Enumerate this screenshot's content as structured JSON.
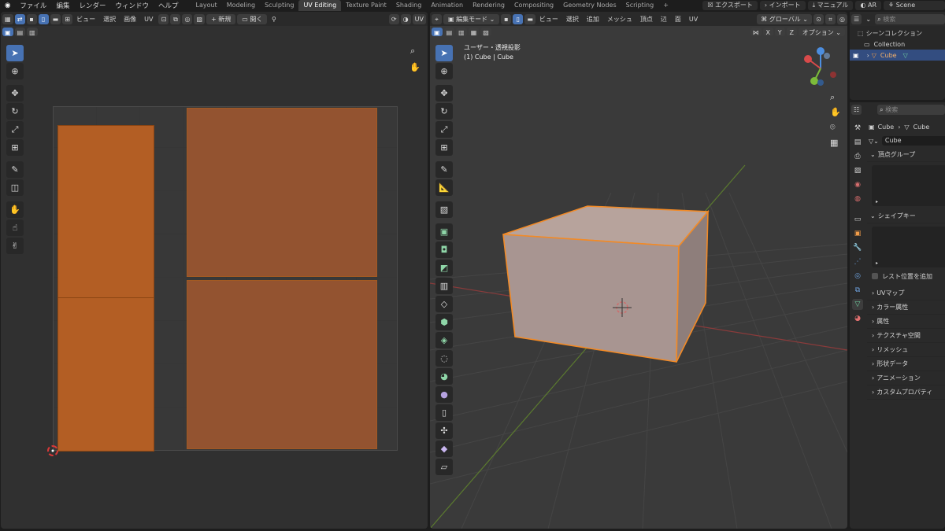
{
  "topbar": {
    "menus": [
      "ファイル",
      "編集",
      "レンダー",
      "ウィンドウ",
      "ヘルプ"
    ],
    "workspaces": [
      "Layout",
      "Modeling",
      "Sculpting",
      "UV Editing",
      "Texture Paint",
      "Shading",
      "Animation",
      "Rendering",
      "Compositing",
      "Geometry Nodes",
      "Scripting"
    ],
    "active_workspace": "UV Editing",
    "add_tab": "+",
    "export": "エクスポート",
    "import": "インポート",
    "manual": "マニュアル",
    "ar": "AR",
    "scene": "Scene"
  },
  "uv_editor": {
    "menus": [
      "ビュー",
      "選択",
      "画像",
      "UV"
    ],
    "new_label": "新規",
    "open_label": "開く",
    "uv_label": "UV"
  },
  "viewport": {
    "mode": "編集モード",
    "menus": [
      "ビュー",
      "選択",
      "追加",
      "メッシュ",
      "頂点",
      "辺",
      "面",
      "UV"
    ],
    "transform": "グローバル",
    "options": "オプション",
    "axes": [
      "X",
      "Y",
      "Z"
    ],
    "overlay_title": "ユーザー・透視投影",
    "overlay_sub": "(1) Cube | Cube"
  },
  "outliner": {
    "search_placeholder": "検索",
    "scene_collection": "シーンコレクション",
    "collection": "Collection",
    "object": "Cube"
  },
  "properties": {
    "search_placeholder": "検索",
    "breadcrumb_object": "Cube",
    "breadcrumb_data": "Cube",
    "mesh_name": "Cube",
    "vertex_groups": "頂点グループ",
    "shape_keys": "シェイプキー",
    "rest_position": "レスト位置を追加",
    "sections": [
      "UVマップ",
      "カラー属性",
      "属性",
      "テクスチャ空間",
      "リメッシュ",
      "形状データ",
      "アニメーション",
      "カスタムプロパティ"
    ]
  },
  "colors": {
    "accent_blue": "#4772b3",
    "selection_orange": "#f28a26",
    "uv_face": "#b35e24"
  }
}
